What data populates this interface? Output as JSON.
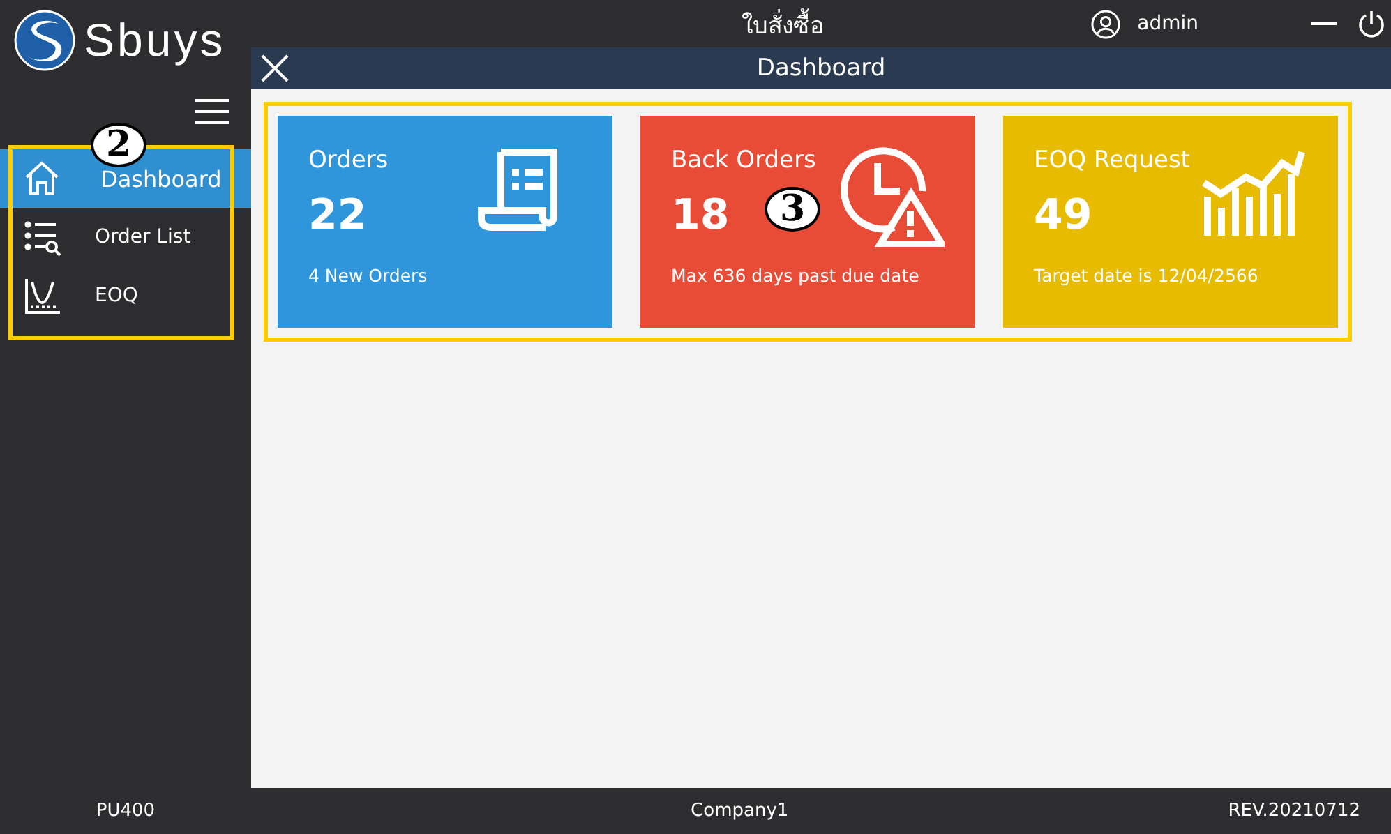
{
  "app": {
    "logo_text": "Sbuys",
    "title": "ใบสั่งซื้อ",
    "user": "admin"
  },
  "sidebar": {
    "items": [
      {
        "label": "Dashboard",
        "selected": true
      },
      {
        "label": "Order List",
        "selected": false
      },
      {
        "label": "EOQ",
        "selected": false
      }
    ]
  },
  "page": {
    "title": "Dashboard"
  },
  "cards": [
    {
      "title": "Orders",
      "value": "22",
      "note": "4 New Orders",
      "color": "#2f96dc"
    },
    {
      "title": "Back Orders",
      "value": "18",
      "note": "Max 636 days past due date",
      "color": "#e84c36"
    },
    {
      "title": "EOQ Request",
      "value": "49",
      "note": "Target date is 12/04/2566",
      "color": "#e6bb00"
    }
  ],
  "callouts": [
    {
      "label": "2"
    },
    {
      "label": "3"
    }
  ],
  "status_bar": {
    "left": "PU400",
    "center": "Company1",
    "right": "REV.20210712"
  }
}
